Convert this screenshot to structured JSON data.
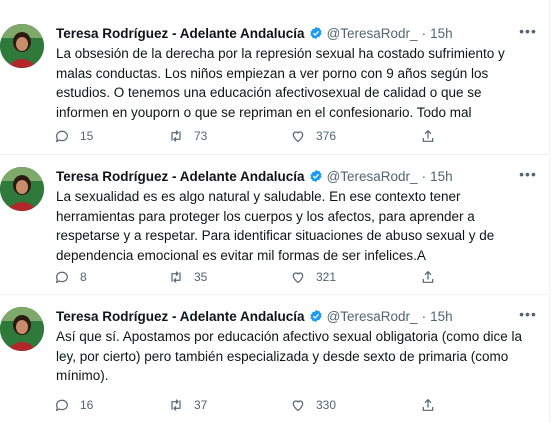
{
  "tweets": [
    {
      "author_name": "Teresa Rodríguez - Adelante Andalucía",
      "handle": "@TeresaRodr_",
      "separator": "·",
      "time": "15h",
      "text": "La obsesión de la derecha por la represión sexual ha costado sufrimiento y malas conductas. Los niños empiezan a ver porno con 9 años según los estudios. O tenemos una educación afectivosexual de calidad o que se informen en youporn o que se repriman en el confesionario. Todo mal",
      "replies": "15",
      "retweets": "73",
      "likes": "376"
    },
    {
      "author_name": "Teresa Rodríguez - Adelante Andalucía",
      "handle": "@TeresaRodr_",
      "separator": "·",
      "time": "15h",
      "text": "La sexualidad es es algo natural y saludable. En ese contexto tener herramientas para proteger los cuerpos y los afectos, para aprender a respetarse y a respetar. Para identificar situaciones de abuso sexual y de dependencia emocional es evitar mil formas de ser infelices.A",
      "replies": "8",
      "retweets": "35",
      "likes": "321"
    },
    {
      "author_name": "Teresa Rodríguez - Adelante Andalucía",
      "handle": "@TeresaRodr_",
      "separator": "·",
      "time": "15h",
      "text": "Así que sí. Apostamos por educación afectivo sexual obligatoria (como dice la ley, por cierto) pero también especializada y desde sexto de primaria (como mínimo).",
      "replies": "16",
      "retweets": "37",
      "likes": "330"
    }
  ],
  "icons": {
    "verified": "verified-badge-icon",
    "more": "more-icon",
    "reply": "reply-icon",
    "retweet": "retweet-icon",
    "like": "like-icon",
    "share": "share-icon"
  },
  "colors": {
    "text": "#0f1419",
    "secondary": "#536471",
    "verified": "#1d9bf0",
    "divider": "#eff3f4"
  }
}
